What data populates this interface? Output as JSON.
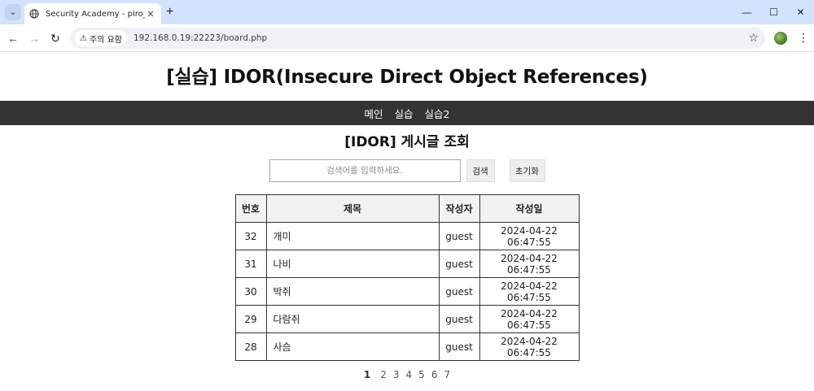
{
  "browser": {
    "tab_title": "Security Academy - piro_im",
    "security_label": "주의 요함",
    "url": "192.168.0.19:22223/board.php"
  },
  "page": {
    "title": "[실습] IDOR(Insecure Direct Object References)",
    "nav": [
      "메인",
      "실습",
      "실습2"
    ],
    "section_title": "[IDOR] 게시글 조회",
    "search": {
      "placeholder": "검색어를 입력하세요.",
      "search_label": "검색",
      "reset_label": "초기화"
    },
    "table": {
      "headers": [
        "번호",
        "제목",
        "작성자",
        "작성일"
      ],
      "rows": [
        {
          "no": "32",
          "title": "개미",
          "author": "guest",
          "date": "2024-04-22 06:47:55"
        },
        {
          "no": "31",
          "title": "나비",
          "author": "guest",
          "date": "2024-04-22 06:47:55"
        },
        {
          "no": "30",
          "title": "박쥐",
          "author": "guest",
          "date": "2024-04-22 06:47:55"
        },
        {
          "no": "29",
          "title": "다람쥐",
          "author": "guest",
          "date": "2024-04-22 06:47:55"
        },
        {
          "no": "28",
          "title": "사슴",
          "author": "guest",
          "date": "2024-04-22 06:47:55"
        }
      ]
    },
    "pagination": {
      "current": "1",
      "pages": [
        "2",
        "3",
        "4",
        "5",
        "6",
        "7"
      ]
    }
  }
}
